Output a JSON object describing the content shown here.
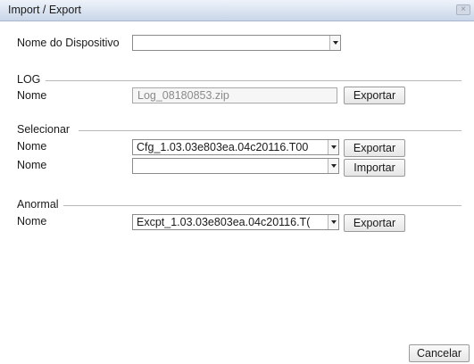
{
  "window": {
    "title": "Import / Export",
    "close_label": "×"
  },
  "device": {
    "label": "Nome do Dispositivo",
    "value": ""
  },
  "log": {
    "section_label": "LOG",
    "name_label": "Nome",
    "file_value": "Log_08180853.zip",
    "export_label": "Exportar"
  },
  "select": {
    "section_label": "Selecionar",
    "row1": {
      "name_label": "Nome",
      "value": "Cfg_1.03.03e803ea.04c20116.T00",
      "export_label": "Exportar"
    },
    "row2": {
      "name_label": "Nome",
      "value": "",
      "import_label": "Importar"
    }
  },
  "abnormal": {
    "section_label": "Anormal",
    "name_label": "Nome",
    "value": "Excpt_1.03.03e803ea.04c20116.T(",
    "export_label": "Exportar"
  },
  "footer": {
    "cancel_label": "Cancelar"
  }
}
